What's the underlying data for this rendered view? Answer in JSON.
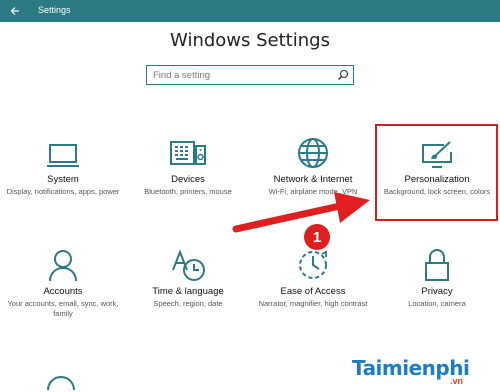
{
  "window": {
    "title": "Settings",
    "back_icon": "back-arrow-icon"
  },
  "heading": "Windows Settings",
  "search": {
    "placeholder": "Find a setting",
    "icon": "search-icon"
  },
  "tiles": [
    {
      "name": "System",
      "desc": "Display, notifications, apps, power",
      "icon": "laptop-icon"
    },
    {
      "name": "Devices",
      "desc": "Bluetooth, printers, mouse",
      "icon": "keyboard-speaker-icon"
    },
    {
      "name": "Network & Internet",
      "desc": "Wi-Fi, airplane mode, VPN",
      "icon": "globe-icon"
    },
    {
      "name": "Personalization",
      "desc": "Background, lock screen, colors",
      "icon": "paint-screen-icon"
    },
    {
      "name": "Accounts",
      "desc": "Your accounts, email, sync, work, family",
      "icon": "person-icon"
    },
    {
      "name": "Time & language",
      "desc": "Speech, region, date",
      "icon": "time-language-icon"
    },
    {
      "name": "Ease of Access",
      "desc": "Narrator, magnifier, high contrast",
      "icon": "ease-of-access-icon"
    },
    {
      "name": "Privacy",
      "desc": "Location, camera",
      "icon": "lock-icon"
    }
  ],
  "annotation": {
    "step_number": "1",
    "colors": {
      "accent": "#2b7a86",
      "highlight": "#d21f1f"
    }
  },
  "watermark": {
    "main": "Taimienphi",
    "sub": ".vn"
  }
}
